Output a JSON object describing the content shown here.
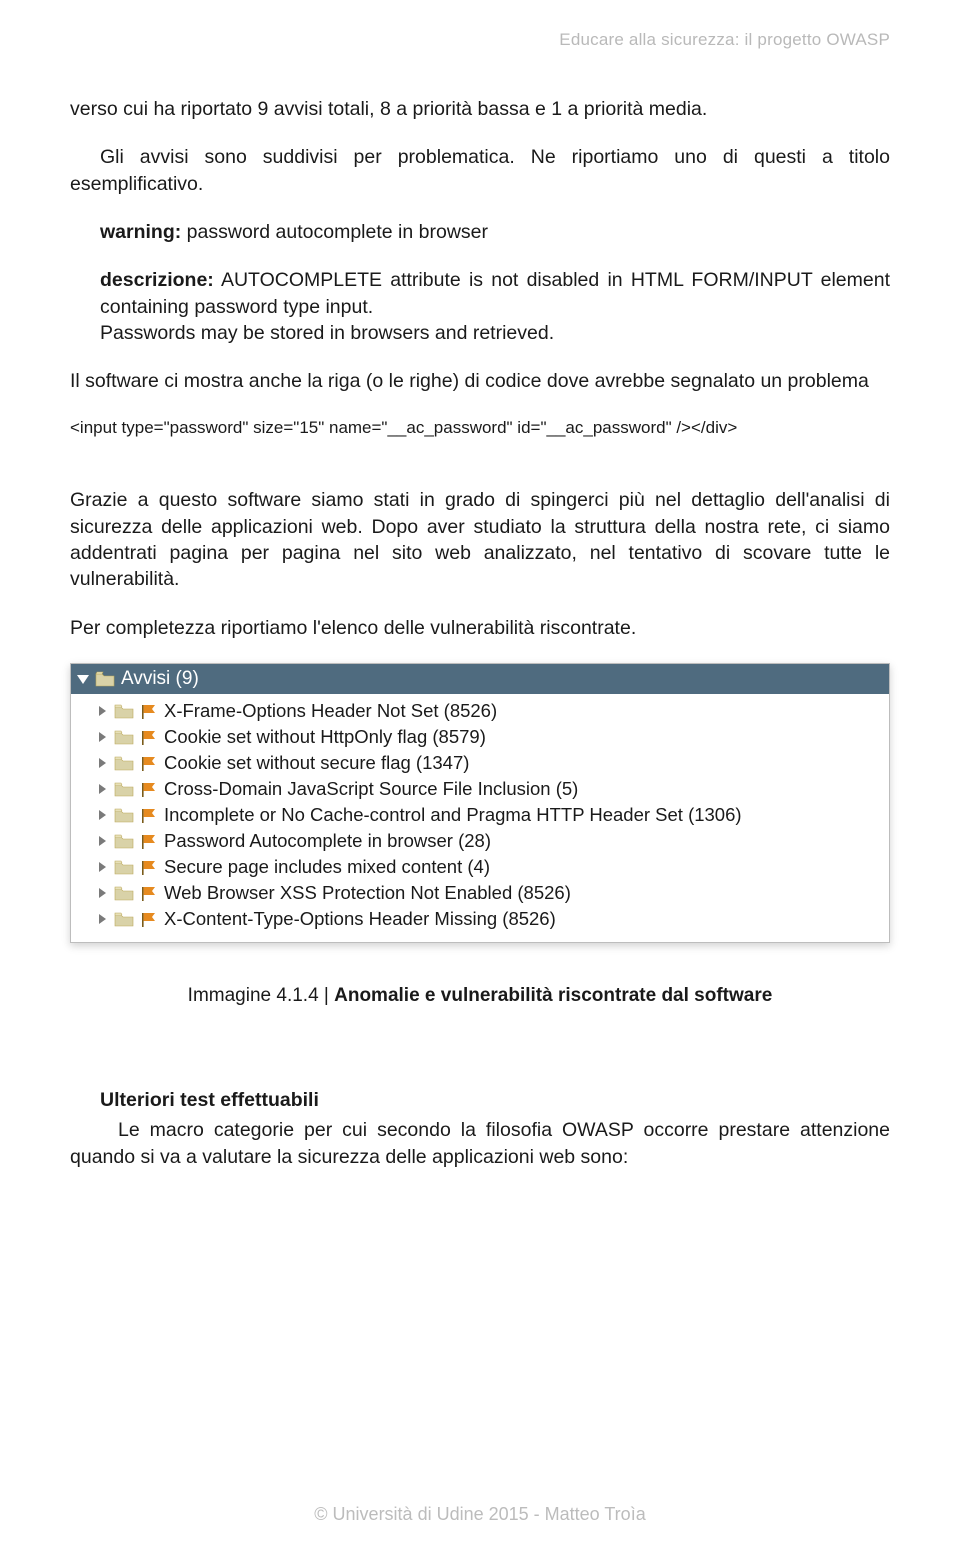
{
  "header": {
    "running_title": "Educare alla sicurezza: il progetto OWASP"
  },
  "body": {
    "p1": "verso cui ha riportato 9 avvisi totali, 8 a priorità bassa e 1 a priorità media.",
    "p2": "Gli avvisi sono suddivisi per problematica. Ne riportiamo uno di questi a titolo esemplificativo.",
    "warning_label": "warning:",
    "warning_text": " password autocomplete in browser",
    "desc_label": "descrizione:",
    "desc_text": " AUTOCOMPLETE attribute is not disabled in HTML FORM/INPUT element containing password type input.",
    "desc_line2": "Passwords may be stored in browsers and retrieved.",
    "p3": "Il software ci mostra anche la riga (o le righe) di codice dove avrebbe segnalato un problema",
    "code_line": "<input type=\"password\" size=\"15\" name=\"__ac_password\" id=\"__ac_password\" /></div>",
    "p4": "Grazie a questo software siamo stati in grado di spingerci più nel dettaglio dell'analisi di sicurezza delle applicazioni web. Dopo aver studiato la struttura della nostra rete, ci siamo addentrati pagina per pagina nel sito web analizzato, nel tentativo di scovare tutte le vulnerabilità.",
    "p5": "Per completezza riportiamo l'elenco delle vulnerabilità riscontrate."
  },
  "alerts_panel": {
    "title": "Avvisi (9)",
    "items": [
      "X-Frame-Options Header Not Set (8526)",
      "Cookie set without HttpOnly flag (8579)",
      "Cookie set without secure flag (1347)",
      "Cross-Domain JavaScript Source File Inclusion (5)",
      "Incomplete or No Cache-control and Pragma HTTP Header Set (1306)",
      "Password Autocomplete in browser (28)",
      "Secure page includes mixed content (4)",
      "Web Browser XSS Protection Not Enabled (8526)",
      "X-Content-Type-Options Header Missing (8526)"
    ]
  },
  "caption": {
    "prefix": "Immagine 4.1.4 | ",
    "bold": "Anomalie e vulnerabilità riscontrate dal software"
  },
  "section": {
    "heading": "Ulteriori test effettuabili",
    "p6": "Le macro categorie per cui secondo la filosofia OWASP occorre prestare attenzione quando si va a valutare la sicurezza delle applicazioni web sono:"
  },
  "footer": {
    "text": "© Università di Udine 2015 - Matteo Troìa"
  },
  "colors": {
    "header_gray": "#b9b9b9",
    "panel_bg": "#4f6b7f",
    "flag_orange": "#e68a1f"
  }
}
